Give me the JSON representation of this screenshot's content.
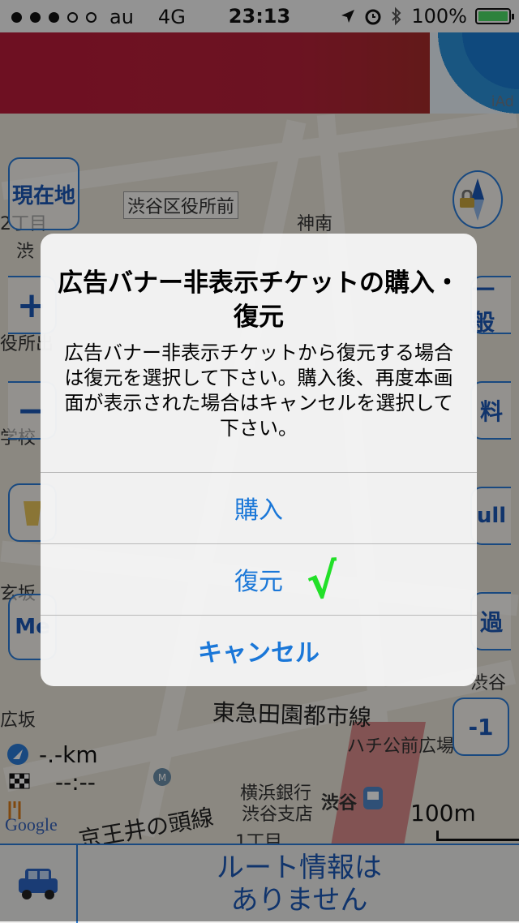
{
  "status_bar": {
    "carrier": "au",
    "network": "4G",
    "time": "23:13",
    "battery_percent": "100%",
    "battery_level": 1.0,
    "icons": [
      "location-arrow-icon",
      "alarm-icon",
      "bluetooth-icon"
    ]
  },
  "ad_banner": {
    "badge": "iAd"
  },
  "map": {
    "labels": {
      "shibuya_ward_office": "渋谷区役所前",
      "jinnan": "神南",
      "tokyu_line": "東急田園都市線",
      "hachiko_square": "ハチ公前広場",
      "yokohama_bank_1": "横浜銀行",
      "yokohama_bank_2": "渋谷支店",
      "shibuya": "渋谷",
      "keio_line": "京王井の頭線",
      "scale": "100m",
      "google": "Google",
      "distance": "-.-km",
      "eta": "--:--",
      "frag_1": "渋",
      "frag_2": "役所出",
      "frag_3": "学校",
      "frag_4": "玄坂",
      "frag_5": "広坂",
      "frag_6": "渋谷",
      "frag_7": "2丁目",
      "frag_8": "1丁目"
    },
    "buttons": {
      "current_location": "現在地",
      "zoom_in": "+",
      "zoom_out": "−",
      "menu": "Me",
      "general": "一般",
      "fee": "料",
      "full": "ull",
      "pass": "過",
      "minus_one": "-1"
    }
  },
  "bottom_bar": {
    "route_line1": "ルート情報は",
    "route_line2": "ありません"
  },
  "dialog": {
    "title": "広告バナー非表示チケットの購入・復元",
    "message": "広告バナー非表示チケットから復元する場合は復元を選択して下さい。購入後、再度本画面が表示された場合はキャンセルを選択して下さい。",
    "buttons": {
      "purchase": "購入",
      "restore": "復元",
      "cancel": "キャンセル"
    },
    "restore_mark": "√"
  },
  "colors": {
    "accent": "#1a77d8",
    "ad_red": "#b81b3a",
    "check_green": "#22e028",
    "route_red": "#d98b8b"
  }
}
